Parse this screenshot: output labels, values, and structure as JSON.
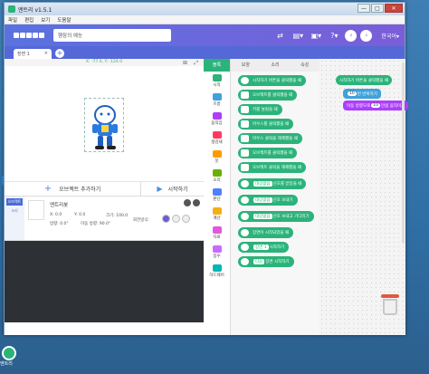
{
  "window": {
    "title": "엔트리 v1.5.1",
    "min": "—",
    "max": "□",
    "close": "✕"
  },
  "menu": [
    "파일",
    "편집",
    "보기",
    "도움말"
  ],
  "header": {
    "project_title": "햄잠의 예능",
    "language": "한국어▾"
  },
  "scene": {
    "tab_label": "장면 1",
    "close": "×",
    "add": "+"
  },
  "stage": {
    "coords": "X: -77.0, Y: -124.0",
    "grid_icon": "⊞",
    "full_icon": "⤢"
  },
  "object_bar": {
    "add_label": "오브젝트 추가하기",
    "start_label": "시작하기"
  },
  "object_side": [
    "오브젝트",
    "소리"
  ],
  "object": {
    "name": "엔트리봇",
    "x": "X: 0.0",
    "y": "Y: 0.0",
    "size": "크기: 100.0",
    "direction": "방향: 0.0°",
    "move_direction": "이동 방향: 90.0°",
    "rotation_label": "회전방식:"
  },
  "palette_tabs": [
    "블록",
    "모양",
    "소리",
    "속성"
  ],
  "categories": [
    {
      "label": "시작",
      "color": "#2bb37a"
    },
    {
      "label": "흐름",
      "color": "#3ea2db"
    },
    {
      "label": "움직임",
      "color": "#ad3efb"
    },
    {
      "label": "생김새",
      "color": "#ff3a61"
    },
    {
      "label": "붓",
      "color": "#ff9b00"
    },
    {
      "label": "소리",
      "color": "#67b100"
    },
    {
      "label": "판단",
      "color": "#4f80ff"
    },
    {
      "label": "계산",
      "color": "#f4af18"
    },
    {
      "label": "자료",
      "color": "#e457dc"
    },
    {
      "label": "함수",
      "color": "#cc6afe"
    },
    {
      "label": "하드웨어",
      "color": "#00b6b1"
    }
  ],
  "blocks": [
    {
      "text": "시작하기 버튼을 클릭했을 때"
    },
    {
      "text": "오브젝트를 클릭했을 때"
    },
    {
      "text": "키를 눌렀을 때"
    },
    {
      "text": "마우스를 클릭했을 때"
    },
    {
      "text": "마우스 클릭을 해제했을 때"
    },
    {
      "text": "오브젝트를 클릭했을 때"
    },
    {
      "text": "오브젝트 클릭을 해제했을 때"
    },
    {
      "text": "신호를 받았을 때",
      "pill": "대상없음"
    },
    {
      "text": "신호 보내기",
      "pill": "대상없음"
    },
    {
      "text": "신호 보내고 기다리기",
      "pill": "대상없음"
    },
    {
      "text": "장면이 시작되었을 때"
    },
    {
      "text": "시작하기",
      "pill": "장면 1"
    },
    {
      "text": "장면 시작하기",
      "pill": "다음"
    }
  ],
  "code": {
    "start": "시작하기 버튼을 클릭했을 때",
    "repeat_num": "10",
    "repeat_text": "번 반복하기",
    "move_pre": "이동 방향으로",
    "move_num": "10",
    "move_text": "만큼 움직이기"
  },
  "desktop": {
    "icon_label": "엔트리"
  }
}
